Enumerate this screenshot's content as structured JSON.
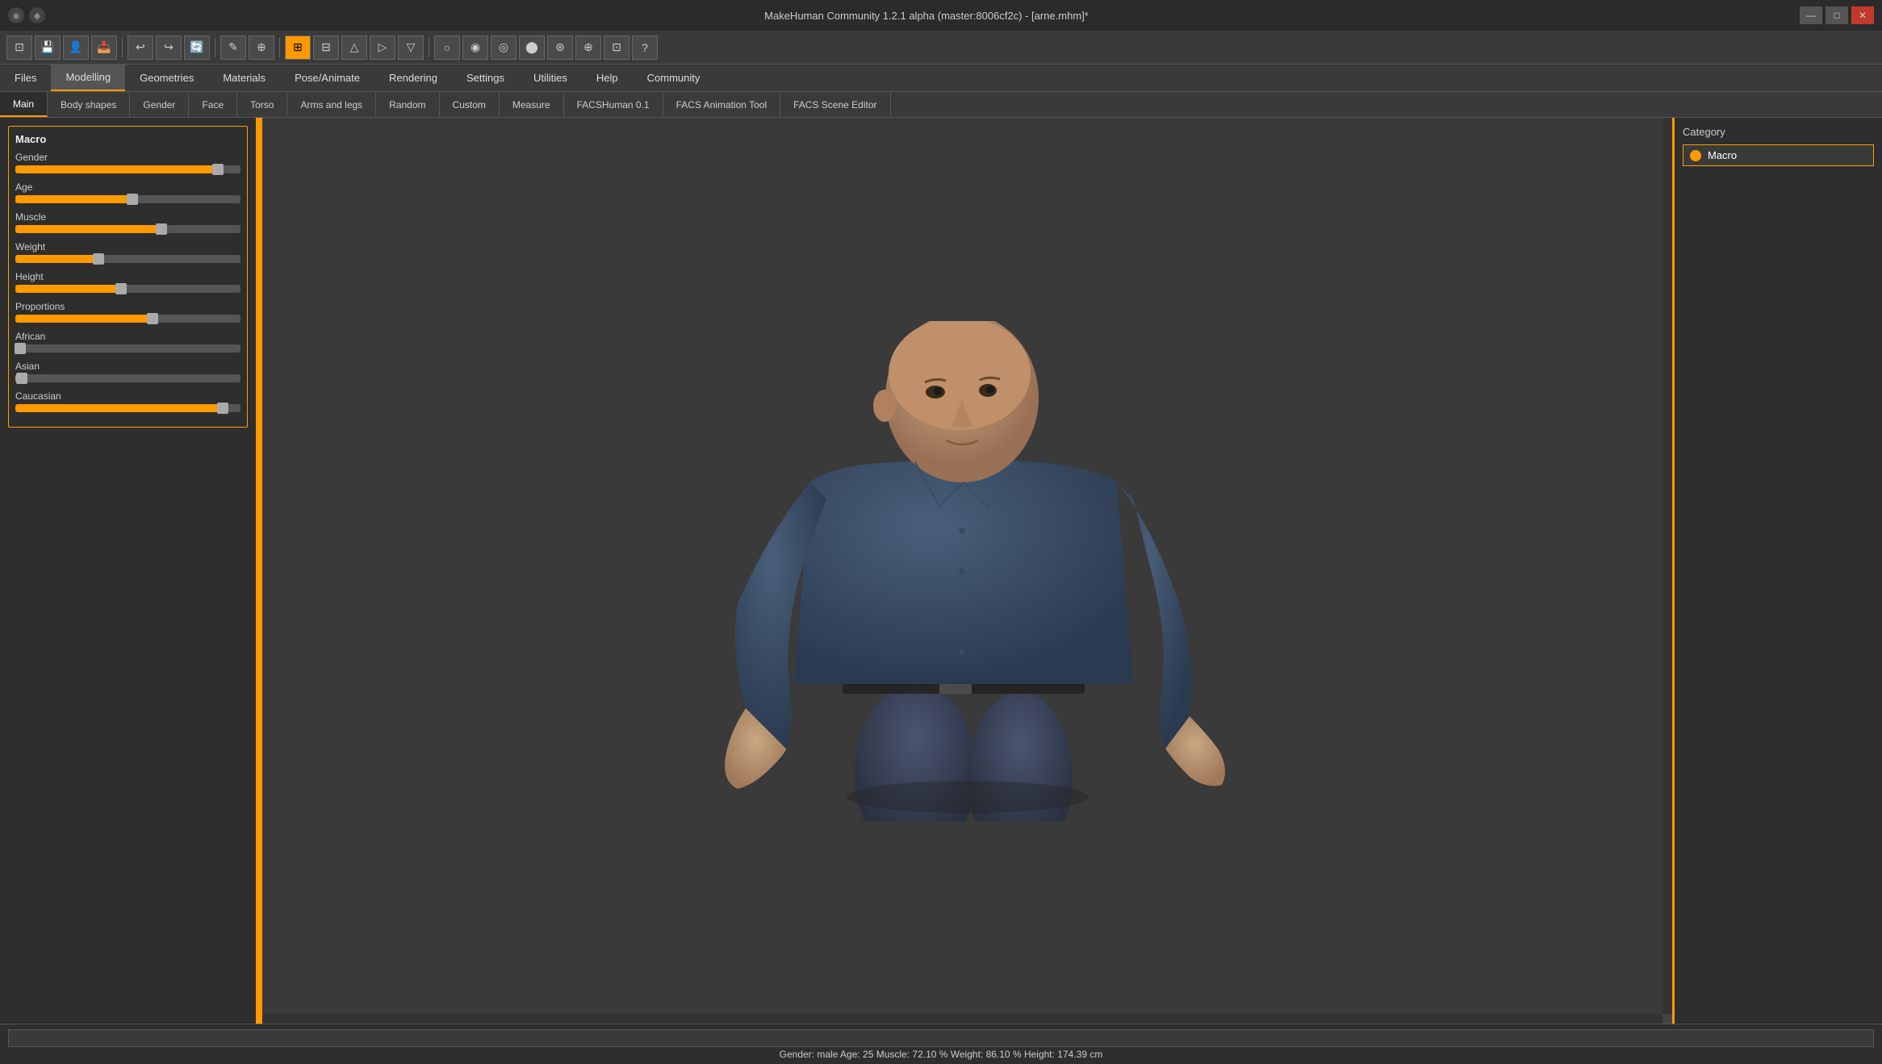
{
  "titlebar": {
    "title": "MakeHuman Community 1.2.1 alpha (master:8006cf2c) - [arne.mhm]*",
    "close_label": "✕",
    "minimize_label": "—",
    "maximize_label": "□",
    "icon1": "◉",
    "icon2": "◆"
  },
  "menubar": {
    "items": [
      {
        "label": "Files",
        "active": false
      },
      {
        "label": "Modelling",
        "active": true
      },
      {
        "label": "Geometries",
        "active": false
      },
      {
        "label": "Materials",
        "active": false
      },
      {
        "label": "Pose/Animate",
        "active": false
      },
      {
        "label": "Rendering",
        "active": false
      },
      {
        "label": "Settings",
        "active": false
      },
      {
        "label": "Utilities",
        "active": false
      },
      {
        "label": "Help",
        "active": false
      },
      {
        "label": "Community",
        "active": false
      }
    ]
  },
  "tabbar": {
    "items": [
      {
        "label": "Main",
        "active": true
      },
      {
        "label": "Body shapes",
        "active": false
      },
      {
        "label": "Gender",
        "active": false
      },
      {
        "label": "Face",
        "active": false
      },
      {
        "label": "Torso",
        "active": false
      },
      {
        "label": "Arms and legs",
        "active": false
      },
      {
        "label": "Random",
        "active": false
      },
      {
        "label": "Custom",
        "active": false
      },
      {
        "label": "Measure",
        "active": false
      },
      {
        "label": "FACSHuman 0.1",
        "active": false
      },
      {
        "label": "FACS Animation Tool",
        "active": false
      },
      {
        "label": "FACS Scene Editor",
        "active": false
      }
    ]
  },
  "toolbar": {
    "buttons": [
      {
        "icon": "⊡",
        "name": "new",
        "active": false
      },
      {
        "icon": "💾",
        "name": "save",
        "active": false
      },
      {
        "icon": "👤",
        "name": "load-human",
        "active": false
      },
      {
        "icon": "📥",
        "name": "import",
        "active": false
      },
      {
        "icon": "↩",
        "name": "undo",
        "active": false
      },
      {
        "icon": "↪",
        "name": "redo",
        "active": false
      },
      {
        "icon": "🔄",
        "name": "reset",
        "active": false
      },
      {
        "icon": "✎",
        "name": "grab",
        "active": false
      },
      {
        "icon": "⊕",
        "name": "smooth",
        "active": false
      },
      {
        "icon": "⊞",
        "name": "wireframe",
        "active": true
      },
      {
        "icon": "⊟",
        "name": "grid",
        "active": false
      },
      {
        "icon": "△",
        "name": "front-view",
        "active": false
      },
      {
        "icon": "▷",
        "name": "right-view",
        "active": false
      },
      {
        "icon": "▽",
        "name": "top-view",
        "active": false
      },
      {
        "icon": "○",
        "name": "head-mesh",
        "active": false
      },
      {
        "icon": "◉",
        "name": "body-mesh",
        "active": false
      },
      {
        "icon": "◎",
        "name": "skin",
        "active": false
      },
      {
        "icon": "⬤",
        "name": "solid",
        "active": false
      },
      {
        "icon": "⊛",
        "name": "overlay",
        "active": false
      },
      {
        "icon": "⊕",
        "name": "zoom",
        "active": false
      },
      {
        "icon": "⊡",
        "name": "camera",
        "active": false
      },
      {
        "icon": "?",
        "name": "help",
        "active": false
      }
    ]
  },
  "macro_panel": {
    "title": "Macro",
    "sliders": [
      {
        "label": "Gender",
        "fill_pct": 90,
        "thumb_pct": 90
      },
      {
        "label": "Age",
        "fill_pct": 52,
        "thumb_pct": 52
      },
      {
        "label": "Muscle",
        "fill_pct": 65,
        "thumb_pct": 65
      },
      {
        "label": "Weight",
        "fill_pct": 37,
        "thumb_pct": 37
      },
      {
        "label": "Height",
        "fill_pct": 47,
        "thumb_pct": 47
      },
      {
        "label": "Proportions",
        "fill_pct": 61,
        "thumb_pct": 61
      },
      {
        "label": "African",
        "fill_pct": 2,
        "thumb_pct": 2
      },
      {
        "label": "Asian",
        "fill_pct": 3,
        "thumb_pct": 3
      },
      {
        "label": "Caucasian",
        "fill_pct": 92,
        "thumb_pct": 92
      }
    ]
  },
  "category_panel": {
    "label": "Category",
    "selected": "Macro"
  },
  "statusbar": {
    "status_text": "Gender: male  Age: 25  Muscle: 72.10 %  Weight: 86.10 %  Height: 174.39 cm",
    "input_placeholder": ""
  }
}
